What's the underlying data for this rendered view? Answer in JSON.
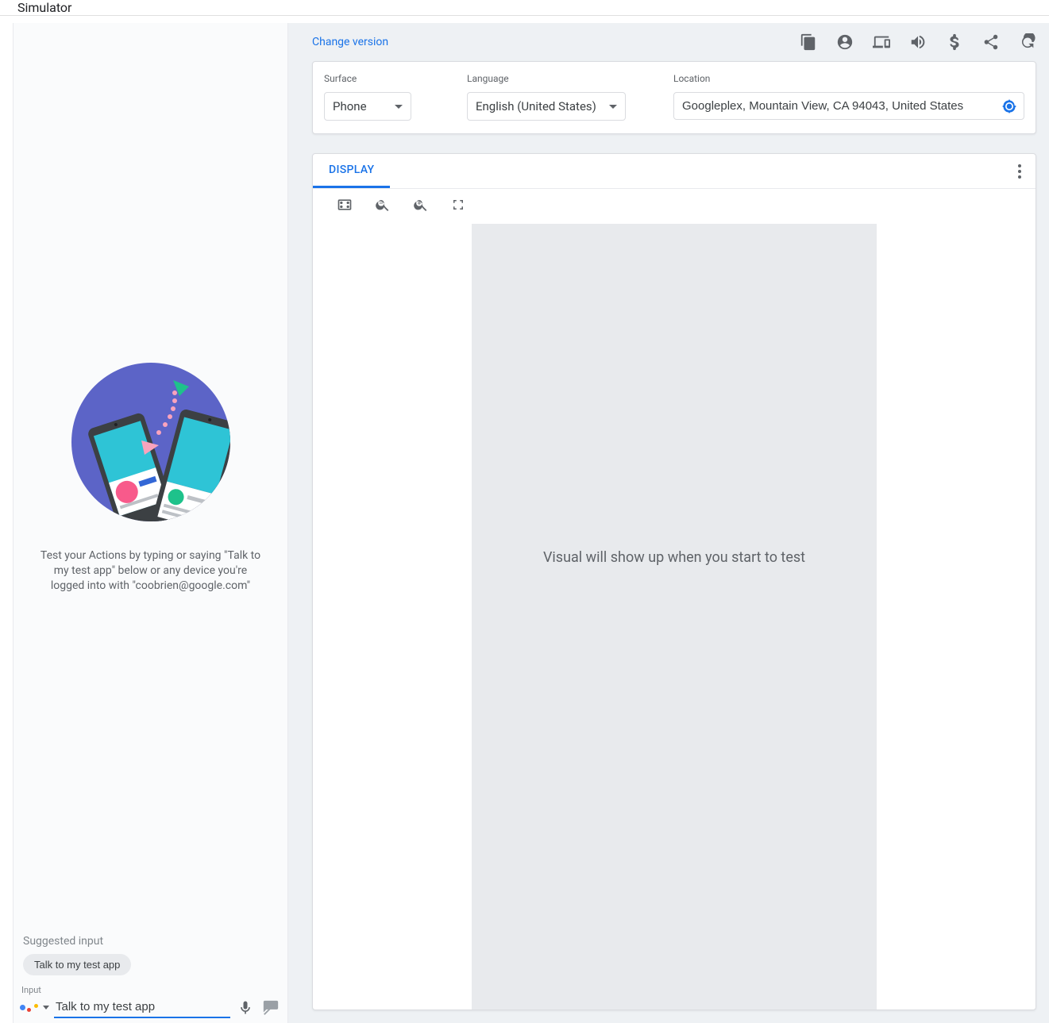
{
  "header": {
    "title": "Simulator"
  },
  "left": {
    "intro": "Test your Actions by typing or saying \"Talk to my test app\" below or any device you're logged into with \"coobrien@google.com\"",
    "suggested_label": "Suggested input",
    "chips": [
      "Talk to my test app"
    ],
    "input_label": "Input",
    "input_value": "Talk to my test app"
  },
  "right": {
    "change_version": "Change version",
    "surface": {
      "label": "Surface",
      "value": "Phone"
    },
    "language": {
      "label": "Language",
      "value": "English (United States)"
    },
    "location": {
      "label": "Location",
      "value": "Googleplex, Mountain View, CA 94043, United States"
    },
    "display_tab": "DISPLAY",
    "stage_text": "Visual will show up when you start to test"
  }
}
